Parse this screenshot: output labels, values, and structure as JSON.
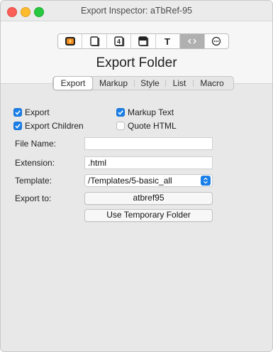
{
  "window": {
    "title": "Export Inspector: aTbRef-95"
  },
  "toolbar": {
    "icons": [
      "general-inspector-icon",
      "appearance-inspector-icon",
      "properties-inspector-icon",
      "action-inspector-icon",
      "text-inspector-icon",
      "export-inspector-icon",
      "data-inspector-icon"
    ],
    "selected_icon": "export-inspector-icon"
  },
  "section": {
    "title": "Export Folder"
  },
  "tabs": {
    "items": [
      "Export",
      "Markup",
      "Style",
      "List",
      "Macro"
    ],
    "selected": "Export"
  },
  "checkboxes": {
    "export": {
      "label": "Export",
      "checked": true
    },
    "markup_text": {
      "label": "Markup Text",
      "checked": true
    },
    "export_children": {
      "label": "Export Children",
      "checked": true
    },
    "quote_html": {
      "label": "Quote HTML",
      "checked": false
    }
  },
  "fields": {
    "file_name": {
      "label": "File Name:",
      "value": ""
    },
    "extension": {
      "label": "Extension:",
      "value": ".html"
    },
    "template": {
      "label": "Template:",
      "value": "/Templates/5-basic_all"
    },
    "export_to": {
      "label": "Export to:",
      "value": "atbref95"
    }
  },
  "buttons": {
    "use_temp_folder": "Use Temporary Folder"
  },
  "colors": {
    "accent": "#1a7fe8",
    "close": "#fc5f57",
    "minimize": "#fdbc2e",
    "maximize": "#28c840"
  }
}
